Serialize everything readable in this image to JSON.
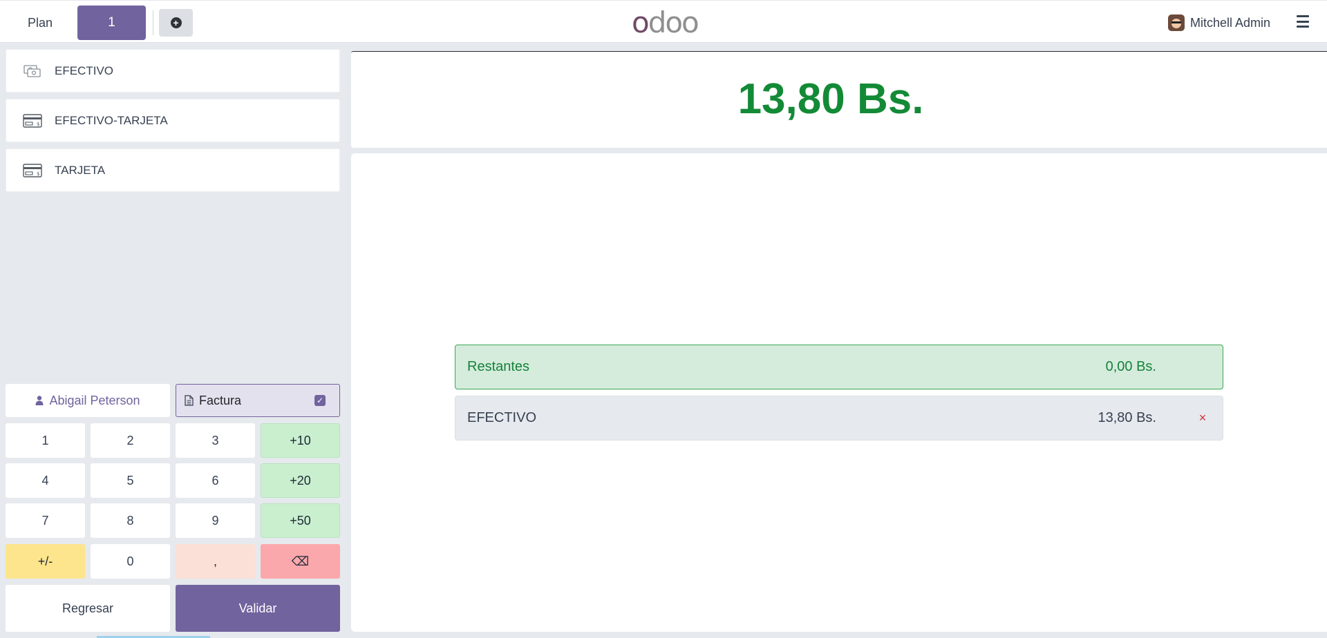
{
  "topbar": {
    "plan_label": "Plan",
    "active_tab": "1",
    "add_tab_icon": "plus-circle",
    "logo_text_first": "o",
    "logo_text_rest": "doo",
    "user_name": "Mitchell Admin"
  },
  "payment_methods": [
    {
      "label": "EFECTIVO",
      "icon": "cash-icon"
    },
    {
      "label": "EFECTIVO-TARJETA",
      "icon": "card-icon"
    },
    {
      "label": "TARJETA",
      "icon": "card-icon"
    }
  ],
  "customer": {
    "name": "Abigail Peterson"
  },
  "invoice": {
    "label": "Factura",
    "checked": true
  },
  "numpad": {
    "row1": [
      "1",
      "2",
      "3",
      "+10"
    ],
    "row2": [
      "4",
      "5",
      "6",
      "+20"
    ],
    "row3": [
      "7",
      "8",
      "9",
      "+50"
    ],
    "row4": [
      "+/-",
      "0",
      ",",
      "⌫"
    ]
  },
  "actions": {
    "back_label": "Regresar",
    "validate_label": "Validar"
  },
  "summary": {
    "total": "13,80 Bs.",
    "remaining_label": "Restantes",
    "remaining_value": "0,00 Bs.",
    "payment_line_name": "EFECTIVO",
    "payment_line_value": "13,80 Bs.",
    "delete_icon": "×"
  },
  "colors": {
    "accent": "#71639e",
    "success": "#138a36",
    "danger": "#d0303a"
  }
}
